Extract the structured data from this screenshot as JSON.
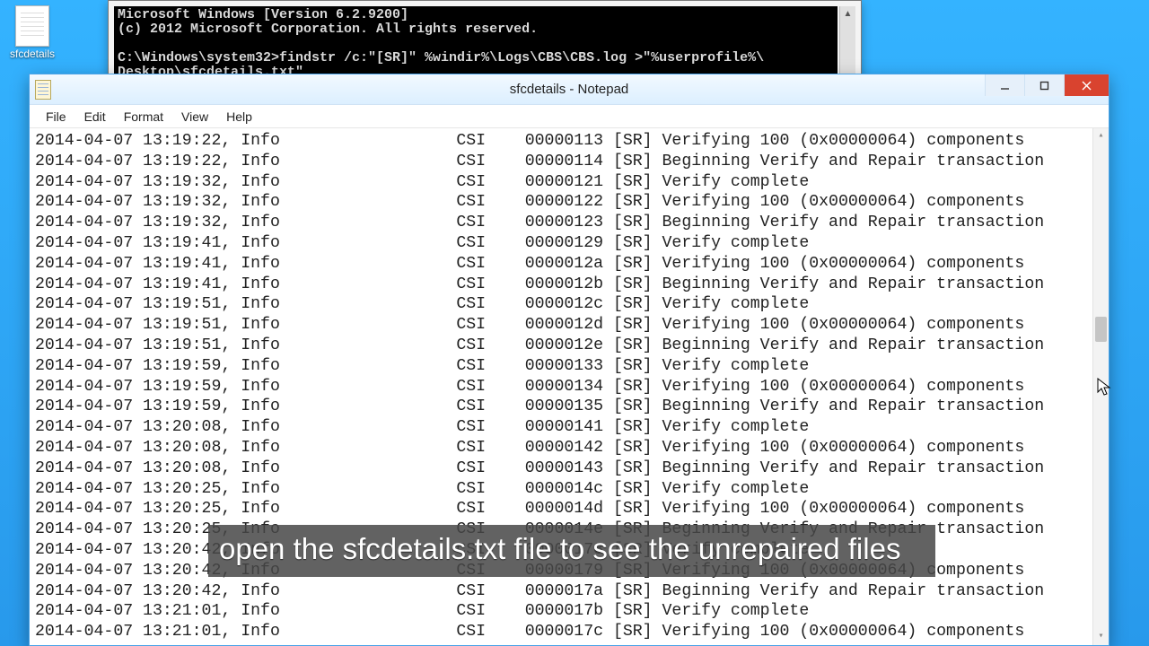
{
  "desktop": {
    "icon_label": "sfcdetails"
  },
  "cmd": {
    "lines": [
      "Microsoft Windows [Version 6.2.9200]",
      "(c) 2012 Microsoft Corporation. All rights reserved.",
      "",
      "C:\\Windows\\system32>findstr /c:\"[SR]\" %windir%\\Logs\\CBS\\CBS.log >\"%userprofile%\\",
      "Desktop\\sfcdetails.txt\""
    ]
  },
  "notepad": {
    "title": "sfcdetails - Notepad",
    "menus": [
      "File",
      "Edit",
      "Format",
      "View",
      "Help"
    ],
    "log_entries": [
      {
        "ts": "2014-04-07 13:19:22",
        "lv": "Info",
        "src": "CSI",
        "id": "00000113",
        "msg": "[SR] Verifying 100 (0x00000064) components"
      },
      {
        "ts": "2014-04-07 13:19:22",
        "lv": "Info",
        "src": "CSI",
        "id": "00000114",
        "msg": "[SR] Beginning Verify and Repair transaction"
      },
      {
        "ts": "2014-04-07 13:19:32",
        "lv": "Info",
        "src": "CSI",
        "id": "00000121",
        "msg": "[SR] Verify complete"
      },
      {
        "ts": "2014-04-07 13:19:32",
        "lv": "Info",
        "src": "CSI",
        "id": "00000122",
        "msg": "[SR] Verifying 100 (0x00000064) components"
      },
      {
        "ts": "2014-04-07 13:19:32",
        "lv": "Info",
        "src": "CSI",
        "id": "00000123",
        "msg": "[SR] Beginning Verify and Repair transaction"
      },
      {
        "ts": "2014-04-07 13:19:41",
        "lv": "Info",
        "src": "CSI",
        "id": "00000129",
        "msg": "[SR] Verify complete"
      },
      {
        "ts": "2014-04-07 13:19:41",
        "lv": "Info",
        "src": "CSI",
        "id": "0000012a",
        "msg": "[SR] Verifying 100 (0x00000064) components"
      },
      {
        "ts": "2014-04-07 13:19:41",
        "lv": "Info",
        "src": "CSI",
        "id": "0000012b",
        "msg": "[SR] Beginning Verify and Repair transaction"
      },
      {
        "ts": "2014-04-07 13:19:51",
        "lv": "Info",
        "src": "CSI",
        "id": "0000012c",
        "msg": "[SR] Verify complete"
      },
      {
        "ts": "2014-04-07 13:19:51",
        "lv": "Info",
        "src": "CSI",
        "id": "0000012d",
        "msg": "[SR] Verifying 100 (0x00000064) components"
      },
      {
        "ts": "2014-04-07 13:19:51",
        "lv": "Info",
        "src": "CSI",
        "id": "0000012e",
        "msg": "[SR] Beginning Verify and Repair transaction"
      },
      {
        "ts": "2014-04-07 13:19:59",
        "lv": "Info",
        "src": "CSI",
        "id": "00000133",
        "msg": "[SR] Verify complete"
      },
      {
        "ts": "2014-04-07 13:19:59",
        "lv": "Info",
        "src": "CSI",
        "id": "00000134",
        "msg": "[SR] Verifying 100 (0x00000064) components"
      },
      {
        "ts": "2014-04-07 13:19:59",
        "lv": "Info",
        "src": "CSI",
        "id": "00000135",
        "msg": "[SR] Beginning Verify and Repair transaction"
      },
      {
        "ts": "2014-04-07 13:20:08",
        "lv": "Info",
        "src": "CSI",
        "id": "00000141",
        "msg": "[SR] Verify complete"
      },
      {
        "ts": "2014-04-07 13:20:08",
        "lv": "Info",
        "src": "CSI",
        "id": "00000142",
        "msg": "[SR] Verifying 100 (0x00000064) components"
      },
      {
        "ts": "2014-04-07 13:20:08",
        "lv": "Info",
        "src": "CSI",
        "id": "00000143",
        "msg": "[SR] Beginning Verify and Repair transaction"
      },
      {
        "ts": "2014-04-07 13:20:25",
        "lv": "Info",
        "src": "CSI",
        "id": "0000014c",
        "msg": "[SR] Verify complete"
      },
      {
        "ts": "2014-04-07 13:20:25",
        "lv": "Info",
        "src": "CSI",
        "id": "0000014d",
        "msg": "[SR] Verifying 100 (0x00000064) components"
      },
      {
        "ts": "2014-04-07 13:20:25",
        "lv": "Info",
        "src": "CSI",
        "id": "0000014e",
        "msg": "[SR] Beginning Verify and Repair transaction"
      },
      {
        "ts": "2014-04-07 13:20:42",
        "lv": "Info",
        "src": "CSI",
        "id": "00000178",
        "msg": "[SR] Verify complete"
      },
      {
        "ts": "2014-04-07 13:20:42",
        "lv": "Info",
        "src": "CSI",
        "id": "00000179",
        "msg": "[SR] Verifying 100 (0x00000064) components"
      },
      {
        "ts": "2014-04-07 13:20:42",
        "lv": "Info",
        "src": "CSI",
        "id": "0000017a",
        "msg": "[SR] Beginning Verify and Repair transaction"
      },
      {
        "ts": "2014-04-07 13:21:01",
        "lv": "Info",
        "src": "CSI",
        "id": "0000017b",
        "msg": "[SR] Verify complete"
      },
      {
        "ts": "2014-04-07 13:21:01",
        "lv": "Info",
        "src": "CSI",
        "id": "0000017c",
        "msg": "[SR] Verifying 100 (0x00000064) components"
      }
    ]
  },
  "subtitle": "open the sfcdetails.txt file to see the unrepaired files"
}
